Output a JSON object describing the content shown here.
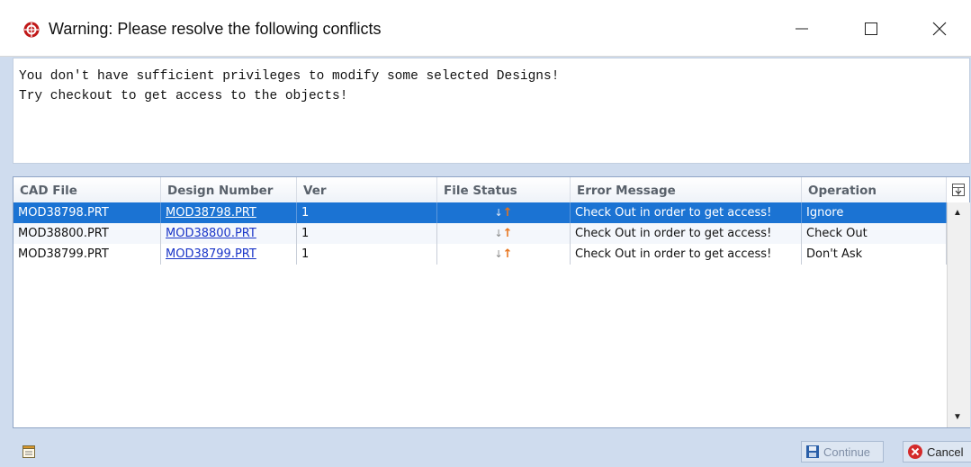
{
  "window": {
    "title": "Warning: Please resolve the following conflicts",
    "icon": "warning-wheel-icon",
    "controls": [
      "minimize-icon",
      "maximize-icon",
      "close-icon"
    ]
  },
  "message": {
    "line1": "You don't have sufficient privileges to modify some selected Designs!",
    "line2": "Try checkout to get access to the objects!"
  },
  "table": {
    "columns": [
      "CAD File",
      "Design Number",
      "Ver",
      "File Status",
      "Error Message",
      "Operation"
    ],
    "rows": [
      {
        "cad_file": "MOD38798.PRT",
        "design_number": "MOD38798.PRT",
        "ver": "1",
        "error": "Check Out in order to get access!",
        "operation": "Ignore",
        "selected": true
      },
      {
        "cad_file": "MOD38800.PRT",
        "design_number": "MOD38800.PRT",
        "ver": "1",
        "error": "Check Out in order to get access!",
        "operation": "Check Out",
        "selected": false
      },
      {
        "cad_file": "MOD38799.PRT",
        "design_number": "MOD38799.PRT",
        "ver": "1",
        "error": "Check Out in order to get access!",
        "operation": "Don't Ask",
        "selected": false
      }
    ],
    "status_icon": "down-up-arrows-icon"
  },
  "footer": {
    "continue_label": "Continue",
    "cancel_label": "Cancel"
  },
  "colors": {
    "selection": "#1b73d3",
    "link": "#1a35c8",
    "background": "#cfdcee",
    "cancel_icon": "#d42a2a"
  }
}
